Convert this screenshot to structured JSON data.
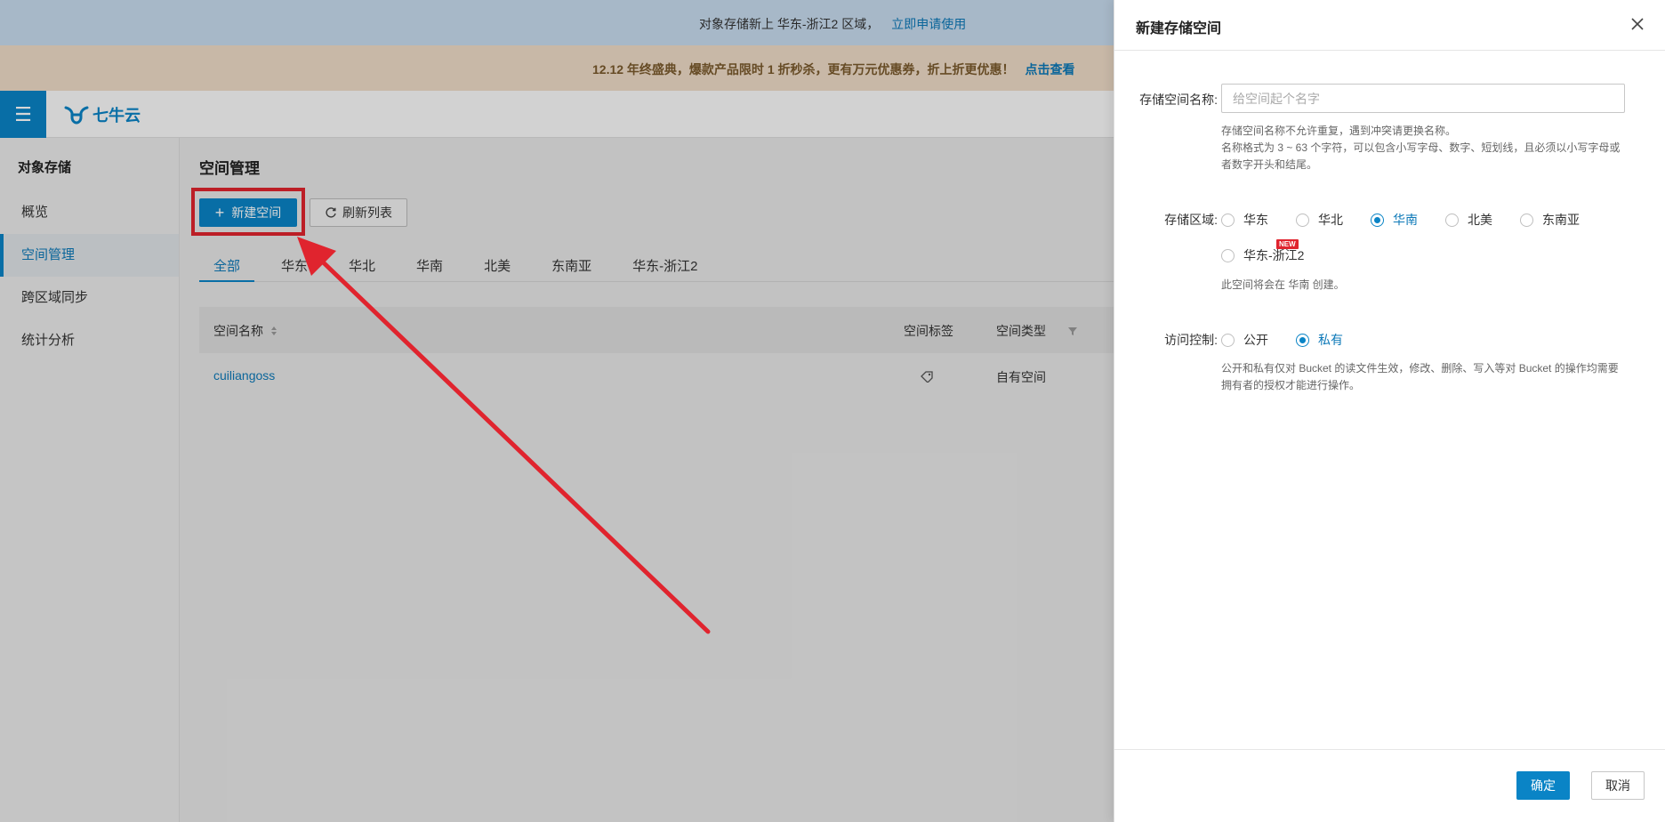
{
  "announcement": {
    "text": "对象存储新上 华东-浙江2 区域，",
    "link": "立即申请使用"
  },
  "promo": {
    "text": "12.12 年终盛典，爆款产品限时 1 折秒杀，更有万元优惠券，折上折更优惠！",
    "link": "点击查看"
  },
  "navbar": {
    "menu_icon": "☰",
    "logo_text": "七牛云"
  },
  "sidebar": {
    "title": "对象存储",
    "items": [
      {
        "label": "概览"
      },
      {
        "label": "空间管理"
      },
      {
        "label": "跨区域同步"
      },
      {
        "label": "统计分析"
      }
    ]
  },
  "main": {
    "page_title": "空间管理",
    "new_button": "新建空间",
    "new_button_icon": "+",
    "refresh_button": "刷新列表",
    "tabs": [
      {
        "label": "全部"
      },
      {
        "label": "华东"
      },
      {
        "label": "华北"
      },
      {
        "label": "华南"
      },
      {
        "label": "北美"
      },
      {
        "label": "东南亚"
      },
      {
        "label": "华东-浙江2"
      }
    ],
    "table": {
      "columns": {
        "name": "空间名称",
        "tags": "空间标签",
        "type": "空间类型"
      },
      "rows": [
        {
          "name": "cuiliangoss",
          "type": "自有空间"
        }
      ]
    }
  },
  "drawer": {
    "title": "新建存储空间",
    "name_label": "存储空间名称:",
    "name_placeholder": "给空间起个名字",
    "name_hint_1": "存储空间名称不允许重复，遇到冲突请更换名称。",
    "name_hint_2": "名称格式为 3 ~ 63 个字符，可以包含小写字母、数字、短划线，且必须以小写字母或者数字开头和结尾。",
    "region_label": "存储区域:",
    "regions": [
      {
        "label": "华东"
      },
      {
        "label": "华北"
      },
      {
        "label": "华南"
      },
      {
        "label": "北美"
      },
      {
        "label": "东南亚"
      },
      {
        "label": "华东-浙江2"
      }
    ],
    "selected_region": "华南",
    "new_badge": "NEW",
    "region_hint": "此空间将会在 华南 创建。",
    "access_label": "访问控制:",
    "access_options": [
      {
        "label": "公开"
      },
      {
        "label": "私有"
      }
    ],
    "selected_access": "私有",
    "access_hint": "公开和私有仅对 Bucket 的读文件生效，修改、删除、写入等对 Bucket 的操作均需要拥有者的授权才能进行操作。",
    "ok_button": "确定",
    "cancel_button": "取消"
  },
  "colors": {
    "accent": "#0a84c6",
    "highlight": "#e0242e",
    "link": "#0d79b8"
  }
}
